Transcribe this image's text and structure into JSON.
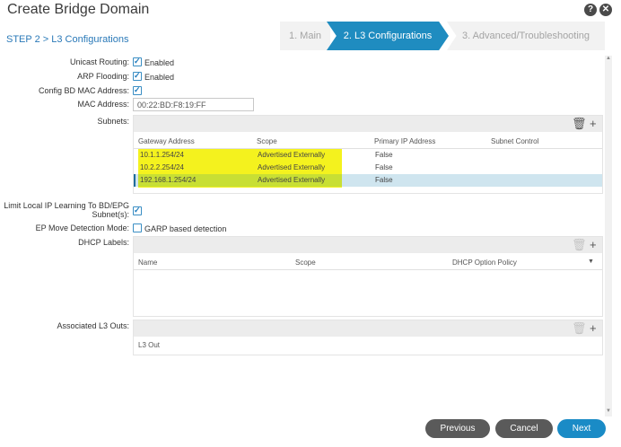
{
  "dialog": {
    "title": "Create Bridge Domain",
    "help_label": "?",
    "close_label": "✕"
  },
  "step_label": "STEP 2 > L3 Configurations",
  "wizard": {
    "steps": [
      {
        "label": "1. Main"
      },
      {
        "label": "2. L3 Configurations"
      },
      {
        "label": "3. Advanced/Troubleshooting"
      }
    ]
  },
  "form": {
    "unicast_routing": {
      "label": "Unicast Routing:",
      "value": "Enabled",
      "checked": true
    },
    "arp_flooding": {
      "label": "ARP Flooding:",
      "value": "Enabled",
      "checked": true
    },
    "config_bd_mac": {
      "label": "Config BD MAC Address:",
      "checked": true
    },
    "mac_address": {
      "label": "MAC Address:",
      "value": "00:22:BD:F8:19:FF"
    },
    "subnets_label": "Subnets:",
    "limit_ip_learning_line1": "Limit Local IP Learning To BD/EPG",
    "limit_ip_learning_line2": "Subnet(s):",
    "ep_move_label": "EP Move Detection Mode:",
    "ep_move_value": "GARP based detection",
    "dhcp_label": "DHCP Labels:",
    "l3outs_label": "Associated L3 Outs:"
  },
  "subnets": {
    "columns": [
      "Gateway Address",
      "Scope",
      "Primary IP Address",
      "Subnet Control"
    ],
    "rows": [
      {
        "gateway": "10.1.1.254/24",
        "scope": "Advertised Externally",
        "primary": "False"
      },
      {
        "gateway": "10.2.2.254/24",
        "scope": "Advertised Externally",
        "primary": "False"
      },
      {
        "gateway": "192.168.1.254/24",
        "scope": "Advertised Externally",
        "primary": "False"
      }
    ]
  },
  "dhcp": {
    "columns": [
      "Name",
      "Scope",
      "DHCP Option Policy"
    ]
  },
  "l3outs": {
    "columns": [
      "L3 Out"
    ]
  },
  "buttons": {
    "previous": "Previous",
    "cancel": "Cancel",
    "next": "Next"
  },
  "icons": {
    "delete": "trash-icon",
    "add": "plus-icon"
  },
  "colors": {
    "accent": "#1f8cc0",
    "highlight": "#f4f21e",
    "selected_row": "#cfe5ef"
  }
}
